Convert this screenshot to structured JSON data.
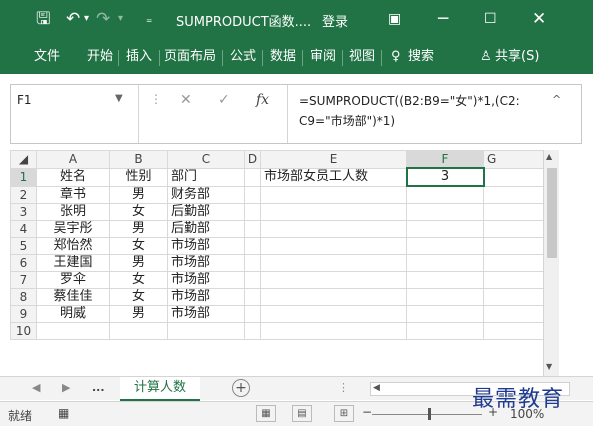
{
  "titlebar": {
    "title": "SUMPRODUCT函数....",
    "login": "登录",
    "save_icon": "save-icon",
    "undo_icon": "undo-icon",
    "redo_icon": "redo-icon",
    "bg": "#217346"
  },
  "ribbon": {
    "tabs": [
      "文件",
      "开始",
      "插入",
      "页面布局",
      "公式",
      "数据",
      "审阅",
      "视图"
    ],
    "search": "搜索",
    "share": "共享(S)"
  },
  "formula_bar": {
    "name_box": "F1",
    "fx": "fx",
    "formula_line1": "=SUMPRODUCT((B2:B9=\"女\")*1,(C2:",
    "formula_line2": "C9=\"市场部\")*1)"
  },
  "grid": {
    "columns": [
      "A",
      "B",
      "C",
      "D",
      "E",
      "F",
      "G"
    ],
    "rows": [
      {
        "n": "1",
        "a": "姓名",
        "b": "性别",
        "c": "部门",
        "e": "市场部女员工人数",
        "f": "3"
      },
      {
        "n": "2",
        "a": "章书",
        "b": "男",
        "c": "财务部",
        "e": "",
        "f": ""
      },
      {
        "n": "3",
        "a": "张明",
        "b": "女",
        "c": "后勤部",
        "e": "",
        "f": ""
      },
      {
        "n": "4",
        "a": "吴宇彤",
        "b": "男",
        "c": "后勤部",
        "e": "",
        "f": ""
      },
      {
        "n": "5",
        "a": "郑怡然",
        "b": "女",
        "c": "市场部",
        "e": "",
        "f": ""
      },
      {
        "n": "6",
        "a": "王建国",
        "b": "男",
        "c": "市场部",
        "e": "",
        "f": ""
      },
      {
        "n": "7",
        "a": "罗伞",
        "b": "女",
        "c": "市场部",
        "e": "",
        "f": ""
      },
      {
        "n": "8",
        "a": "蔡佳佳",
        "b": "女",
        "c": "市场部",
        "e": "",
        "f": ""
      },
      {
        "n": "9",
        "a": "明威",
        "b": "男",
        "c": "市场部",
        "e": "",
        "f": ""
      },
      {
        "n": "10",
        "a": "",
        "b": "",
        "c": "",
        "e": "",
        "f": ""
      }
    ]
  },
  "sheets": {
    "active": "计算人数",
    "more": "..."
  },
  "statusbar": {
    "ready": "就绪",
    "zoom": "100%"
  },
  "watermark": "最需教育"
}
